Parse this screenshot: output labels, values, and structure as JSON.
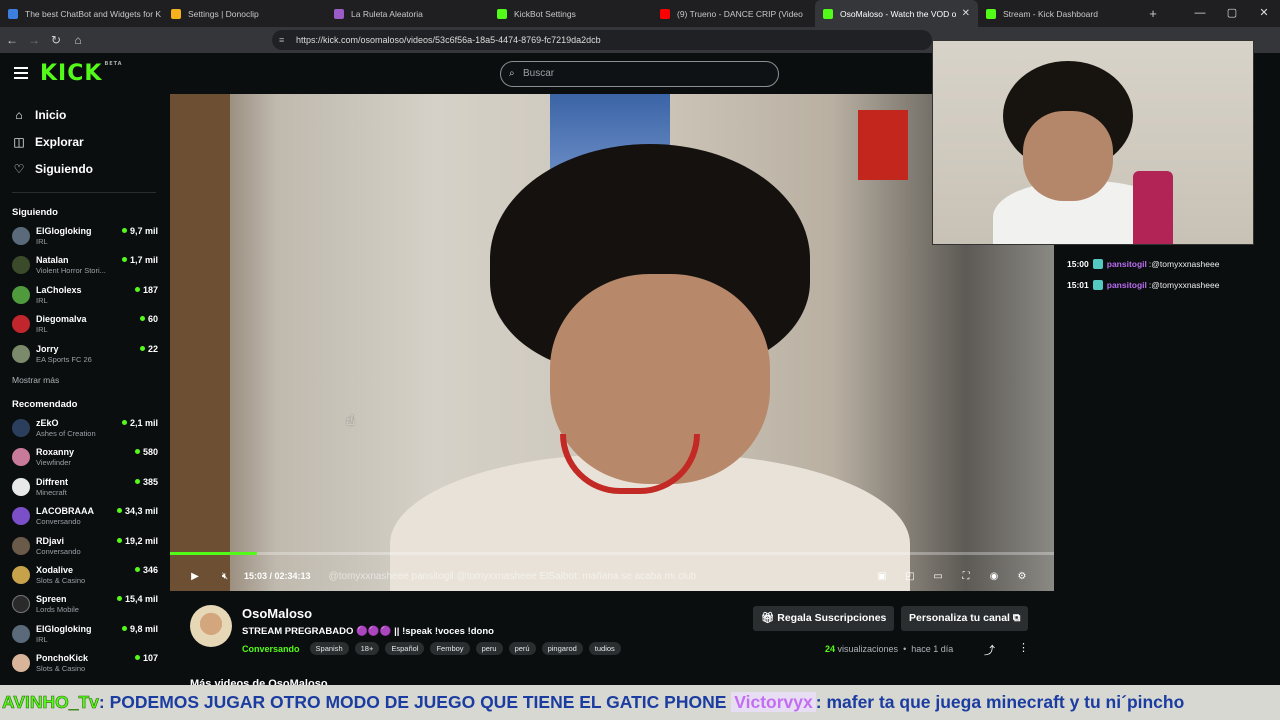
{
  "browser": {
    "tabs": [
      {
        "label": "The best ChatBot and Widgets for K",
        "color": "#3d7fe0"
      },
      {
        "label": "Settings | Donoclip",
        "color": "#f5b21b"
      },
      {
        "label": "La Ruleta Aleatoria",
        "color": "#9c5cc7"
      },
      {
        "label": "KickBot Settings",
        "color": "#53fc18"
      },
      {
        "label": "(9) Trueno - DANCE CRIP (Video",
        "color": "#ff0000"
      },
      {
        "label": "OsoMaloso - Watch the VOD o",
        "color": "#53fc18"
      },
      {
        "label": "Stream - Kick Dashboard",
        "color": "#53fc18"
      }
    ],
    "url": "https://kick.com/osomaloso/videos/53c6f56a-18a5-4474-8769-fc7219da2dcb"
  },
  "header": {
    "logo": "KICK",
    "logo_badge": "BETA",
    "search_placeholder": "Buscar"
  },
  "sidebar": {
    "nav": [
      {
        "label": "Inicio",
        "icon": "home-icon"
      },
      {
        "label": "Explorar",
        "icon": "compass-icon"
      },
      {
        "label": "Siguiendo",
        "icon": "heart-icon"
      }
    ],
    "following_title": "Siguiendo",
    "following": [
      {
        "name": "ElGlogloking",
        "category": "IRL",
        "viewers": "9,7 mil",
        "color": "#5a6a7a"
      },
      {
        "name": "Natalan",
        "category": "Violent Horror Stori...",
        "viewers": "1,7 mil",
        "color": "#3a4a2a"
      },
      {
        "name": "LaCholexs",
        "category": "IRL",
        "viewers": "187",
        "color": "#4e9a3c"
      },
      {
        "name": "Diegomalva",
        "category": "IRL",
        "viewers": "60",
        "color": "#c0262c"
      },
      {
        "name": "Jorry",
        "category": "EA Sports FC 26",
        "viewers": "22",
        "color": "#7a8a6a"
      }
    ],
    "show_more": "Mostrar más",
    "recommended_title": "Recomendado",
    "recommended": [
      {
        "name": "zEkO",
        "category": "Ashes of Creation",
        "viewers": "2,1 mil",
        "color": "#2b3e5c"
      },
      {
        "name": "Roxanny",
        "category": "Viewfinder",
        "viewers": "580",
        "color": "#c77a9a"
      },
      {
        "name": "Diffrent",
        "category": "Minecraft",
        "viewers": "385",
        "color": "#e8e8e8"
      },
      {
        "name": "LACOBRAAA",
        "category": "Conversando",
        "viewers": "34,3 mil",
        "color": "#7a4fc7"
      },
      {
        "name": "RDjavi",
        "category": "Conversando",
        "viewers": "19,2 mil",
        "color": "#6a5a4a"
      },
      {
        "name": "Xodalive",
        "category": "Slots & Casino",
        "viewers": "346",
        "color": "#c7a24a"
      },
      {
        "name": "Spreen",
        "category": "Lords Mobile",
        "viewers": "15,4 mil",
        "color": "#2a2a2a"
      },
      {
        "name": "ElGlogloking",
        "category": "IRL",
        "viewers": "9,8 mil",
        "color": "#5a6a7a"
      },
      {
        "name": "PonchoKick",
        "category": "Slots & Casino",
        "viewers": "107",
        "color": "#d8b49a"
      }
    ]
  },
  "player": {
    "time": "15:03 / 02:34:13",
    "progress": 0.098,
    "overlay_text": "@tomyxxnasheee  pansitogil  @tomyxxnasheee  ElSaibot: mañana se acaba mi club"
  },
  "chat": [
    {
      "time": "15:00",
      "user": "pansitogil",
      "text": "@tomyxxnasheee"
    },
    {
      "time": "15:01",
      "user": "pansitogil",
      "text": "@tomyxxnasheee"
    }
  ],
  "video_info": {
    "channel": "OsoMaloso",
    "title": "STREAM PREGRABADO 🟣🟣🟣 || !speak !voces !dono",
    "category": "Conversando",
    "tags": [
      "Spanish",
      "18+",
      "Español",
      "Femboy",
      "peru",
      "perú",
      "pingarod",
      "tudios"
    ],
    "gift_button": "Regala Suscripciones",
    "customize_button": "Personaliza tu canal",
    "views_count": "24",
    "views_label": "visualizaciones",
    "ago": "hace 1 día",
    "more_videos": "Más videos de OsoMaloso"
  },
  "ticker": {
    "user1": "AVINHO_Tv",
    "msg1": ": PODEMOS JUGAR OTRO MODO DE JUEGO QUE TIENE EL GATIC PHONE",
    "user2": "Victorvyx",
    "msg2": ": mafer ta que juega minecraft y tu ni´pincho"
  }
}
